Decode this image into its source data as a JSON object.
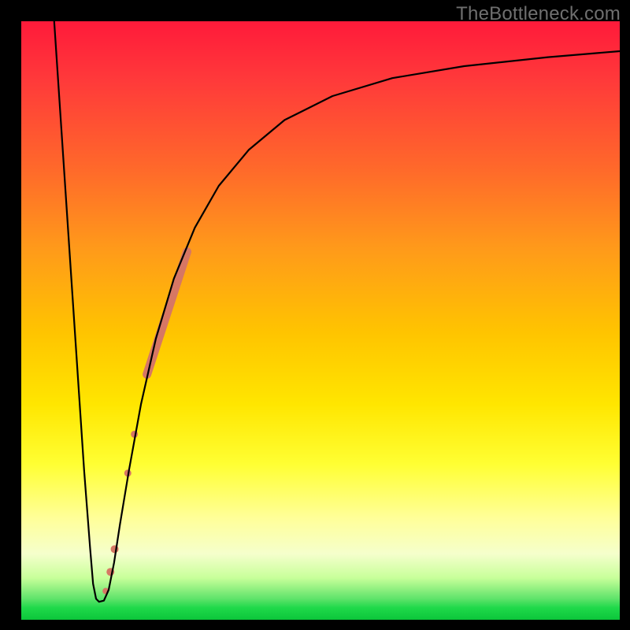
{
  "watermark": "TheBottleneck.com",
  "chart_data": {
    "type": "line",
    "title": "",
    "xlabel": "",
    "ylabel": "",
    "xlim": [
      0,
      100
    ],
    "ylim": [
      0,
      100
    ],
    "grid": false,
    "legend": false,
    "series": [
      {
        "name": "curve",
        "stroke": "#000000",
        "x": [
          5.5,
          6.5,
          7.5,
          8.5,
          9.5,
          10.5,
          11.5,
          12.0,
          12.5,
          13.0,
          13.8,
          14.6,
          15.5,
          16.5,
          18.0,
          20.0,
          22.5,
          25.5,
          29.0,
          33.0,
          38.0,
          44.0,
          52.0,
          62.0,
          74.0,
          88.0,
          100.0
        ],
        "y": [
          100.0,
          85.0,
          70.0,
          55.0,
          40.0,
          25.0,
          12.0,
          6.0,
          3.5,
          3.0,
          3.2,
          5.0,
          9.5,
          16.0,
          25.0,
          36.0,
          47.0,
          57.0,
          65.5,
          72.5,
          78.5,
          83.5,
          87.5,
          90.5,
          92.5,
          94.0,
          95.0
        ]
      }
    ],
    "annotations": {
      "coral_stroke": {
        "color": "#d67764",
        "segments": [
          {
            "x": [
              21.0,
              27.7
            ],
            "y": [
              41.0,
              61.5
            ],
            "width": 11
          }
        ],
        "dots": [
          {
            "x": 18.9,
            "y": 31.0,
            "r": 4.5
          },
          {
            "x": 17.8,
            "y": 24.5,
            "r": 4.5
          },
          {
            "x": 14.9,
            "y": 8.0,
            "r": 5.0
          },
          {
            "x": 15.6,
            "y": 11.8,
            "r": 5.0
          },
          {
            "x": 14.1,
            "y": 4.8,
            "r": 4.0
          }
        ]
      }
    }
  }
}
